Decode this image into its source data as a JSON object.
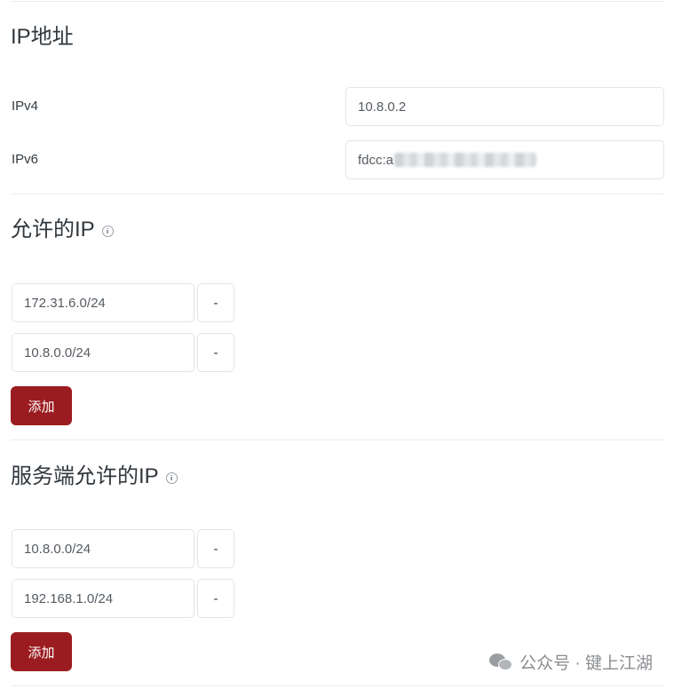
{
  "ip_section": {
    "title": "IP地址",
    "ipv4_label": "IPv4",
    "ipv4_value": "10.8.0.2",
    "ipv6_label": "IPv6",
    "ipv6_value": "fdcc:a"
  },
  "allowed_ips": {
    "title": "允许的IP",
    "entries": [
      "172.31.6.0/24",
      "10.8.0.0/24"
    ],
    "remove_label": "-",
    "add_label": "添加"
  },
  "server_allowed_ips": {
    "title": "服务端允许的IP",
    "entries": [
      "10.8.0.0/24",
      "192.168.1.0/24"
    ],
    "remove_label": "-",
    "add_label": "添加"
  },
  "watermark": {
    "text": "公众号 · 键上江湖"
  },
  "colors": {
    "accent": "#9b1c20",
    "border": "#e3e5e8",
    "divider": "#ececec"
  }
}
